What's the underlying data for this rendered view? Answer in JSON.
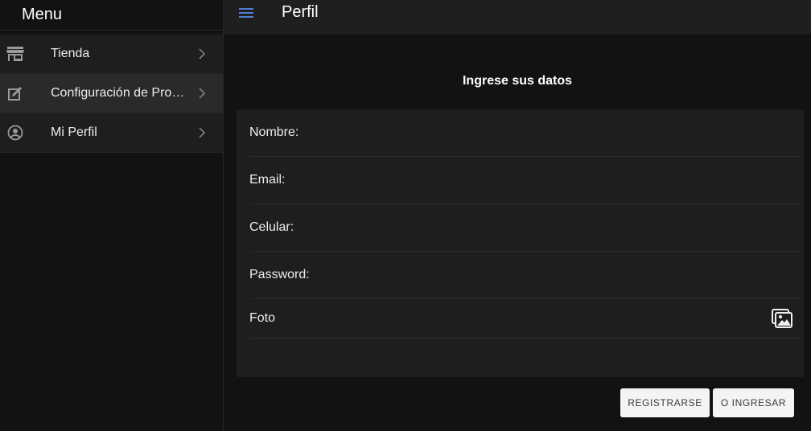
{
  "sidebar": {
    "title": "Menu",
    "items": [
      {
        "label": "Tienda",
        "icon": "store-icon"
      },
      {
        "label": "Configuración de Productos",
        "icon": "edit-icon"
      },
      {
        "label": "Mi Perfil",
        "icon": "user-circle-icon"
      }
    ]
  },
  "header": {
    "menu_icon": "hamburger-icon",
    "title": "Perfil"
  },
  "form": {
    "title": "Ingrese sus datos",
    "fields": [
      {
        "label": "Nombre:",
        "value": ""
      },
      {
        "label": "Email:",
        "value": ""
      },
      {
        "label": "Celular:",
        "value": ""
      },
      {
        "label": "Password:",
        "value": ""
      }
    ],
    "photo_label": "Foto",
    "photo_icon": "images-icon"
  },
  "actions": {
    "register_label": "REGISTRARSE",
    "login_label": "O INGRESAR"
  },
  "colors": {
    "accent": "#4f7fd6",
    "background": "#121212",
    "surface": "#1e1e1e"
  }
}
